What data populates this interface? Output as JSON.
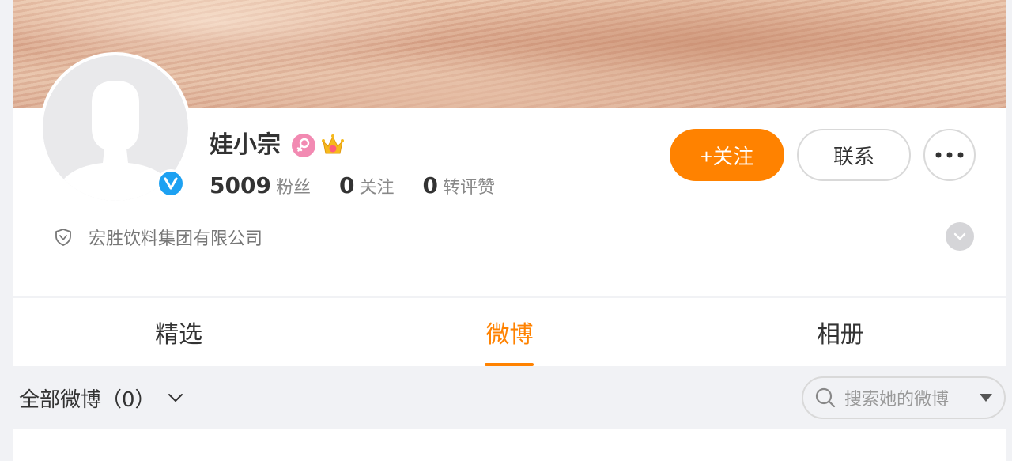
{
  "profile": {
    "name": "娃小宗",
    "stats": [
      {
        "num": "5009",
        "label": "粉丝"
      },
      {
        "num": "0",
        "label": "关注"
      },
      {
        "num": "0",
        "label": "转评赞"
      }
    ],
    "company": "宏胜饮料集团有限公司"
  },
  "actions": {
    "follow_label": "+关注",
    "contact_label": "联系"
  },
  "tabs": [
    {
      "label": "精选",
      "active": false
    },
    {
      "label": "微博",
      "active": true
    },
    {
      "label": "相册",
      "active": false
    }
  ],
  "feed": {
    "filter_label": "全部微博（0）",
    "search_placeholder": "搜索她的微博"
  },
  "colors": {
    "accent": "#ff8200",
    "verified": "#1da1f2",
    "female_badge": "#f28ab2"
  }
}
